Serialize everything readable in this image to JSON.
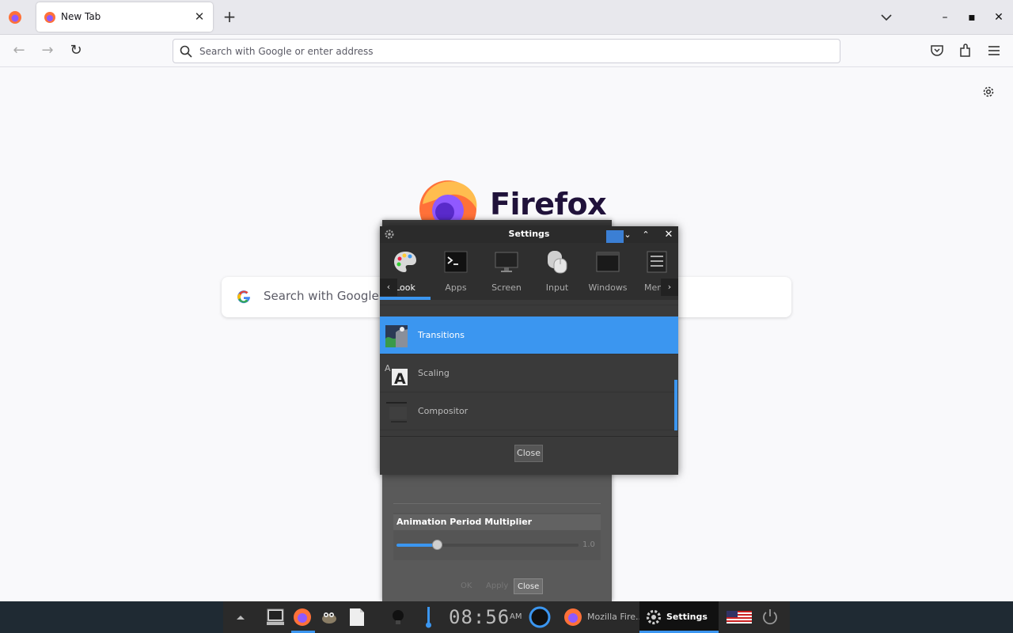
{
  "browser": {
    "tab_title": "New Tab",
    "urlbar_placeholder": "Search with Google or enter address"
  },
  "newtab": {
    "wordmark": "Firefox",
    "search_placeholder": "Search with Google or"
  },
  "transitions_dialog": {
    "slider_label": "Animation Period Multiplier",
    "slider_value_text": "1.0",
    "slider_level": 0.22,
    "buttons": [
      "OK",
      "Apply",
      "Close"
    ]
  },
  "settings": {
    "title": "Settings",
    "categories": [
      "Look",
      "Apps",
      "Screen",
      "Input",
      "Windows",
      "Menus"
    ],
    "active_category": "Look",
    "items": [
      "Transitions",
      "Scaling",
      "Compositor"
    ],
    "selected_item": "Transitions",
    "close_label": "Close"
  },
  "taskbar": {
    "clock": "08:56",
    "ampm": "AM",
    "tasks": [
      "Mozilla Fire...",
      "Settings"
    ],
    "active_task": "Settings"
  },
  "colors": {
    "accent": "#3b96f0",
    "dialog_bg": "#3a3a3a",
    "taskbar_bg": "#1f2a33"
  }
}
